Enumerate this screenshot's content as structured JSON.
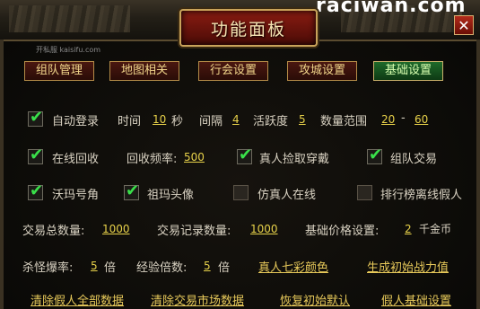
{
  "header": {
    "title": "功能面板",
    "watermark_top": "raciwan.com",
    "close_label": "✕",
    "site_watermark": "开私服 kaisifu.com"
  },
  "tabs": [
    {
      "label": "组队管理",
      "active": false
    },
    {
      "label": "地图相关",
      "active": false
    },
    {
      "label": "行会设置",
      "active": false
    },
    {
      "label": "攻城设置",
      "active": false
    },
    {
      "label": "基础设置",
      "active": true
    }
  ],
  "row1": {
    "auto_login": {
      "label": "自动登录",
      "checked": true
    },
    "time_label": "时间",
    "time_value": "10",
    "time_unit": "秒",
    "interval_label": "间隔",
    "interval_value": "4",
    "activity_label": "活跃度",
    "activity_value": "5",
    "range_label": "数量范围",
    "range_min": "20",
    "range_sep": "-",
    "range_max": "60"
  },
  "row2": {
    "online_recycle": {
      "label": "在线回收",
      "checked": true
    },
    "recycle_freq_label": "回收频率:",
    "recycle_freq_value": "500",
    "real_pickup": {
      "label": "真人捡取穿戴",
      "checked": true
    },
    "team_trade": {
      "label": "组队交易",
      "checked": true
    }
  },
  "row3": {
    "wama_horn": {
      "label": "沃玛号角",
      "checked": true
    },
    "zuma_head": {
      "label": "祖玛头像",
      "checked": true
    },
    "fake_online": {
      "label": "仿真人在线",
      "checked": false
    },
    "rank_offline": {
      "label": "排行榜离线假人",
      "checked": false
    }
  },
  "row4": {
    "trade_total_label": "交易总数量:",
    "trade_total_value": "1000",
    "trade_record_label": "交易记录数量:",
    "trade_record_value": "1000",
    "base_price_label": "基础价格设置:",
    "base_price_value": "2",
    "base_price_unit": "千金币"
  },
  "row5": {
    "kill_rate_label": "杀怪爆率:",
    "kill_rate_value": "5",
    "kill_rate_unit": "倍",
    "exp_label": "经验倍数:",
    "exp_value": "5",
    "exp_unit": "倍",
    "color_link": "真人七彩颜色",
    "power_link": "生成初始战力值"
  },
  "row6": {
    "clear_fake": "清除假人全部数据",
    "clear_market": "清除交易市场数据",
    "restore_default": "恢复初始默认",
    "fake_base": "假人基础设置"
  }
}
